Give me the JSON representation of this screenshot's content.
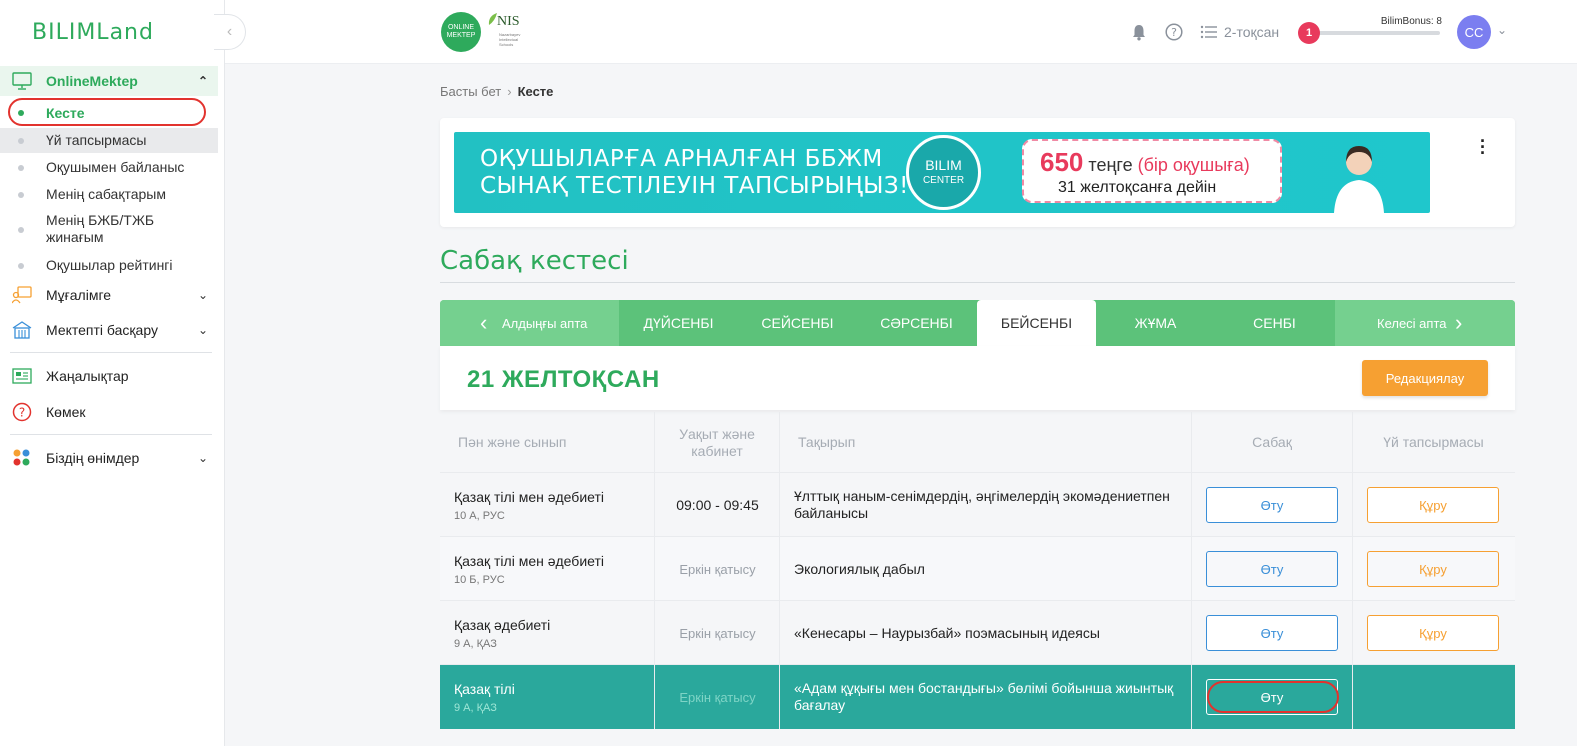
{
  "app": {
    "logo_text": "BILIMLand",
    "collapse_icon": "chevron-left-icon"
  },
  "sidebar": {
    "online_mektep": {
      "label": "OnlineMektep",
      "items": [
        {
          "label": "Кесте",
          "active": true
        },
        {
          "label": "Үй тапсырмасы"
        },
        {
          "label": "Оқушымен байланыс"
        },
        {
          "label": "Менің сабақтарым"
        },
        {
          "label": "Менің БЖБ/ТЖБ жинағым"
        },
        {
          "label": "Оқушылар рейтингі"
        }
      ]
    },
    "groups": [
      {
        "label": "Мұғалімге"
      },
      {
        "label": "Мектепті басқару"
      },
      {
        "label": "Жаңалықтар"
      },
      {
        "label": "Көмек"
      },
      {
        "label": "Біздің өнімдер"
      }
    ]
  },
  "topbar": {
    "om_logo_text": "ONLINE MEKTEP",
    "nis_logo_text": "NIS",
    "nis_sub": "Nazarbayev Intellectual Schools",
    "quarter_label": "2-тоқсан",
    "bonus_label": "BilimBonus: 8",
    "bonus_level": "1",
    "bonus_progress": 0.05,
    "avatar_initials": "CC"
  },
  "breadcrumb": {
    "home": "Басты бет",
    "current": "Кесте"
  },
  "banner": {
    "line1": "ОҚУШЫЛАРҒА АРНАЛҒАН ББЖМ",
    "line2": "СЫНАҚ ТЕСТІЛЕУІН ТАПСЫРЫҢЫЗ!",
    "brand_top": "BILIM",
    "brand_bottom": "CENTER",
    "price": "650",
    "price_unit": "теңге",
    "price_note": "(бір оқушыға)",
    "deadline": "31 желтоқсанға дейін"
  },
  "schedule": {
    "title": "Сабақ кестесі",
    "prev_week": "Алдыңғы апта",
    "next_week": "Келесі апта",
    "days": [
      "ДҮЙСЕНБІ",
      "СЕЙСЕНБІ",
      "СӘРСЕНБІ",
      "БЕЙСЕНБІ",
      "ЖҰМА",
      "СЕНБІ"
    ],
    "active_day": "БЕЙСЕНБІ",
    "date": "21 ЖЕЛТОҚСАН",
    "edit_button": "Редакциялау",
    "columns": [
      "Пән және сынып",
      "Уақыт және кабинет",
      "Тақырып",
      "Сабақ",
      "Үй тапсырмасы"
    ],
    "rows": [
      {
        "subject": "Қазақ тілі мен әдебиеті",
        "class": "10 А, РУС",
        "time": "09:00 - 09:45",
        "topic": "Ұлттық наным-сенімдердің, әңгімелердің экомәдениетпен байланысы",
        "lesson_btn": "Өту",
        "hw_btn": "Құру"
      },
      {
        "subject": "Қазақ тілі мен әдебиеті",
        "class": "10 Б, РУС",
        "time": "Еркін қатысу",
        "topic": "Экологиялық дабыл",
        "lesson_btn": "Өту",
        "hw_btn": "Құру"
      },
      {
        "subject": "Қазақ әдебиеті",
        "class": "9 А, ҚАЗ",
        "time": "Еркін қатысу",
        "topic": "«Кенесары – Наурызбай» поэмасының идеясы",
        "lesson_btn": "Өту",
        "hw_btn": "Құру"
      },
      {
        "subject": "Қазақ тілі",
        "class": "9 А, ҚАЗ",
        "time": "Еркін қатысу",
        "topic": "«Адам құқығы мен бостандығы» бөлімі бойынша жиынтық бағалау",
        "lesson_btn": "Өту",
        "hw_btn": ""
      }
    ]
  },
  "colors": {
    "brand_green": "#2eaa5c",
    "tab_bar": "#5cc27a",
    "highlight_row": "#2aa89c",
    "orange": "#f6a032",
    "blue": "#3a8fd8",
    "annotation_red": "#e2332e"
  }
}
